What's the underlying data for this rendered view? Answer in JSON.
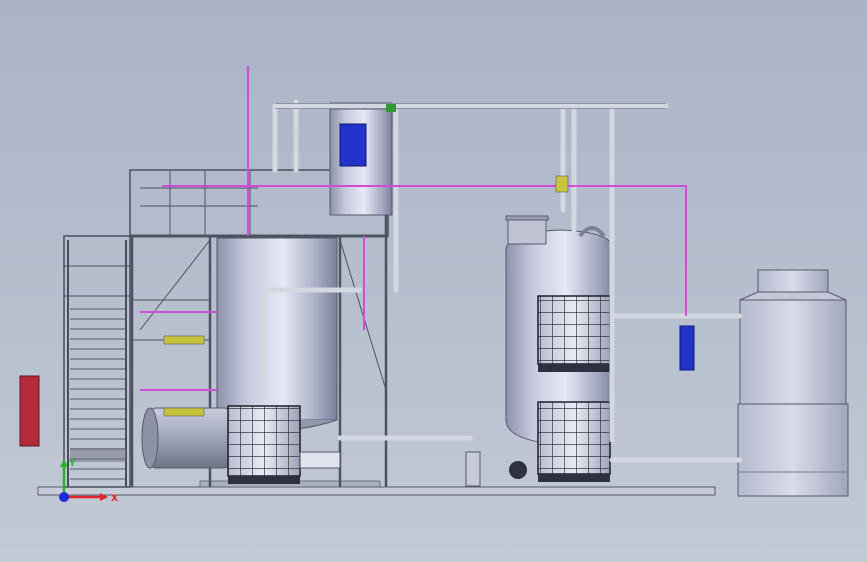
{
  "viewport": {
    "background_top": "#aab4c6",
    "background_bottom": "#c3cad6"
  },
  "colors": {
    "steel": "#b9bfd0",
    "steel_dark": "#7e8598",
    "tank_light": "#e4e7f3",
    "tank_mid": "#aeb3cb",
    "tank_dark": "#7d8298",
    "pipe": "#d3d7df",
    "magenta_pipe": "#d24dd6",
    "blue_panel": "#2233cc",
    "red_cabinet": "#b52a3a",
    "green_fitting": "#2f9a2f",
    "yellow_fitting": "#c8c23a",
    "ibc_cage": "#ffffff"
  },
  "axis_triad": {
    "x_label": "X",
    "y_label": "Y",
    "x_color": "#e0242c",
    "y_color": "#2cb12c",
    "z_color": "#1a2cd8"
  },
  "components": [
    {
      "name": "base-skid"
    },
    {
      "name": "access-staircase"
    },
    {
      "name": "platform-structure"
    },
    {
      "name": "reactor-tank-main"
    },
    {
      "name": "overhead-vessel"
    },
    {
      "name": "separator-tank"
    },
    {
      "name": "ibc-container",
      "count": 3
    },
    {
      "name": "cooling-tower"
    },
    {
      "name": "control-cabinet"
    },
    {
      "name": "horizontal-drum"
    }
  ]
}
